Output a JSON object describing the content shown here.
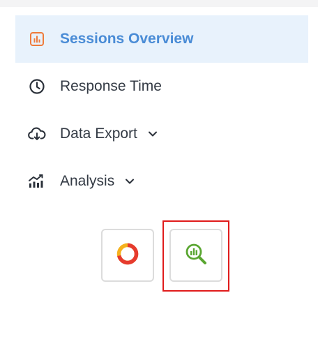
{
  "nav": {
    "items": [
      {
        "label": "Sessions Overview",
        "icon": "bar-chart-icon",
        "active": true
      },
      {
        "label": "Response Time",
        "icon": "clock-icon"
      },
      {
        "label": "Data Export",
        "icon": "cloud-download-icon",
        "expandable": true
      },
      {
        "label": "Analysis",
        "icon": "analytics-icon",
        "expandable": true
      }
    ]
  },
  "tools": [
    {
      "icon": "ring-icon"
    },
    {
      "icon": "search-chart-icon",
      "highlighted": true
    }
  ],
  "colors": {
    "active_text": "#4a8cd6",
    "active_bg": "#e8f2fc",
    "active_icon": "#ef7a3a",
    "text": "#333a44",
    "highlight": "#e01b1b",
    "search_icon": "#5aa631"
  }
}
